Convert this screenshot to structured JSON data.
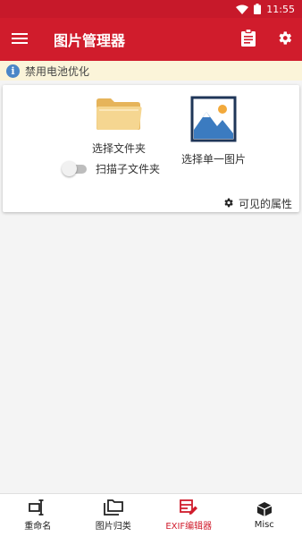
{
  "status_bar": {
    "time": "11:55"
  },
  "app_bar": {
    "title": "图片管理器"
  },
  "notice": {
    "info_glyph": "i",
    "text": "禁用电池优化"
  },
  "card": {
    "select_folder_label": "选择文件夹",
    "select_image_label": "选择单一图片",
    "scan_subfolders_label": "扫描子文件夹",
    "scan_subfolders_enabled": false,
    "visible_attributes_label": "可见的属性"
  },
  "bottom_nav": {
    "items": [
      {
        "label": "重命名",
        "icon": "rename-icon",
        "active": false
      },
      {
        "label": "图片归类",
        "icon": "folders-icon",
        "active": false
      },
      {
        "label": "EXIF编辑器",
        "icon": "exif-edit-icon",
        "active": true
      },
      {
        "label": "Misc",
        "icon": "cube-icon",
        "active": false
      }
    ]
  },
  "colors": {
    "primary": "#d01c2c",
    "status_bar": "#c7192a",
    "notice_background": "#fbf4d9",
    "info_icon": "#4a86c7"
  }
}
